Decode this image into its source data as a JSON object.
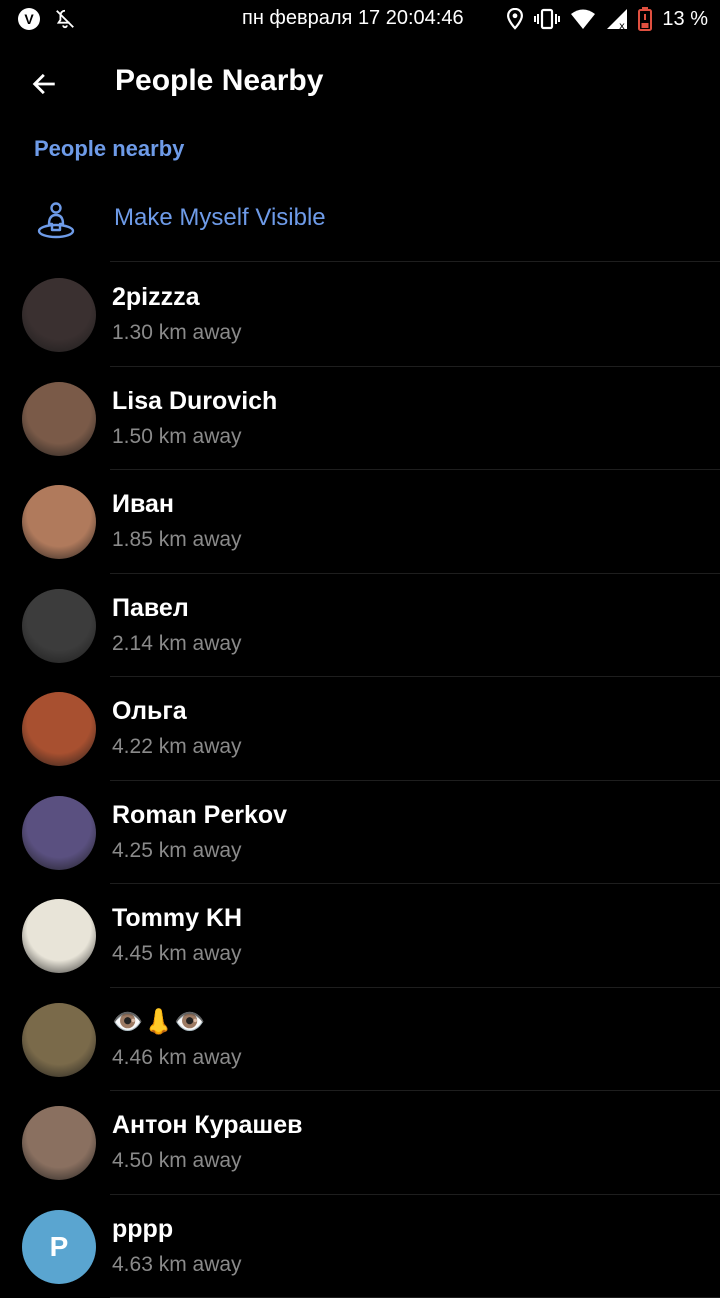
{
  "status_bar": {
    "clock": "пн февраля 17 20:04:46",
    "battery": "13 %",
    "icons": [
      "viber-icon",
      "notifications-off-icon",
      "location-icon",
      "vibrate-icon",
      "wifi-icon",
      "signal-icon",
      "battery-low-icon"
    ]
  },
  "toolbar": {
    "back_icon": "arrow-left-icon",
    "title": "People Nearby"
  },
  "section": {
    "header": "People nearby",
    "make_visible_label": "Make Myself Visible",
    "make_visible_icon": "person-pin-icon"
  },
  "colors": {
    "accent": "#6e9be8",
    "background": "#000000",
    "secondary_text": "#8a8a8a",
    "divider": "#1e1e1e"
  },
  "people": [
    {
      "name": "2pizzza",
      "distance": "1.30 km away",
      "avatar_color": "#3a3030",
      "avatar_letter": ""
    },
    {
      "name": "Lisa Durovich",
      "distance": "1.50 km away",
      "avatar_color": "#7a5a48",
      "avatar_letter": ""
    },
    {
      "name": "Иван",
      "distance": "1.85 km away",
      "avatar_color": "#b07a5c",
      "avatar_letter": ""
    },
    {
      "name": "Павел",
      "distance": "2.14 km away",
      "avatar_color": "#3c3c3c",
      "avatar_letter": ""
    },
    {
      "name": "Ольга",
      "distance": "4.22 km away",
      "avatar_color": "#a85030",
      "avatar_letter": ""
    },
    {
      "name": "Roman Perkov",
      "distance": "4.25 km away",
      "avatar_color": "#5a5080",
      "avatar_letter": ""
    },
    {
      "name": "Tommy KH",
      "distance": "4.45 km away",
      "avatar_color": "#e8e4d8",
      "avatar_letter": ""
    },
    {
      "name": "👁️👃👁️",
      "distance": "4.46 km away",
      "avatar_color": "#7a6a4a",
      "avatar_letter": ""
    },
    {
      "name": "Антон Курашев",
      "distance": "4.50 km away",
      "avatar_color": "#8a7060",
      "avatar_letter": ""
    },
    {
      "name": "pppp",
      "distance": "4.63 km away",
      "avatar_color": "#5aa5d0",
      "avatar_letter": "P"
    }
  ]
}
